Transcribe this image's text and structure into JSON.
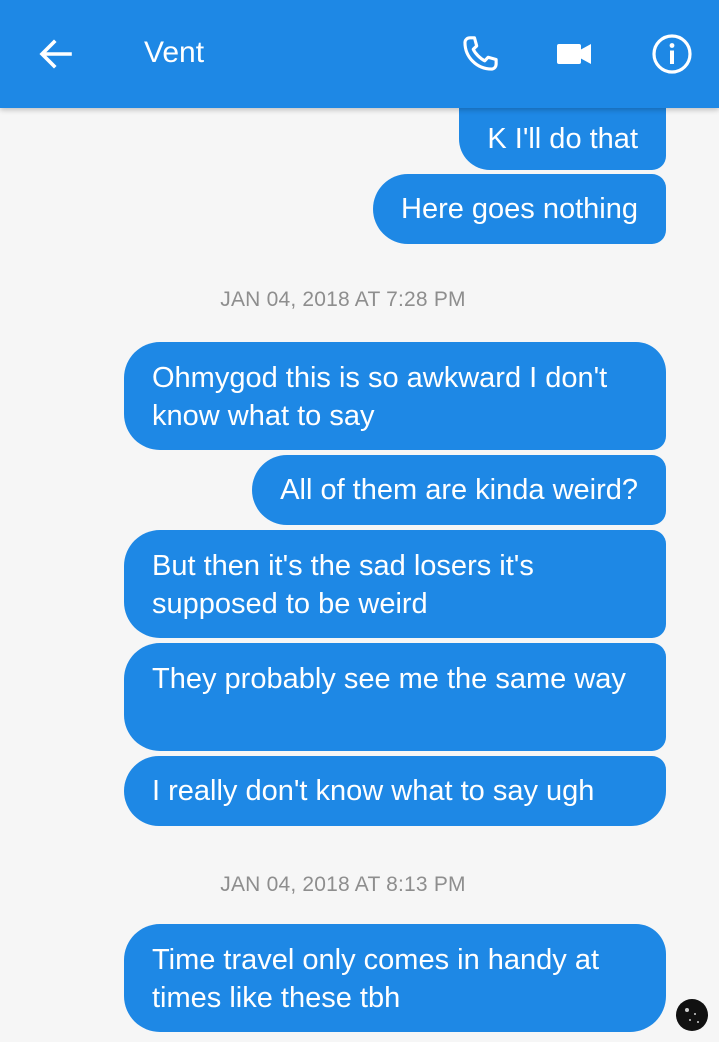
{
  "header": {
    "title": "Vent",
    "icons": {
      "back": "arrow-left-icon",
      "call": "phone-icon",
      "video": "video-camera-icon",
      "info": "info-icon"
    }
  },
  "colors": {
    "accent": "#1e88e5",
    "background": "#f6f6f6",
    "timestamp": "#8e8e8e"
  },
  "messages": {
    "m1": "K I'll do that",
    "m2": "Here goes nothing",
    "t1": "JAN 04, 2018 AT 7:28 PM",
    "m3": "Ohmygod this is so awkward I don't know what to say",
    "m4": "All of them are kinda weird?",
    "m5": "But then it's the sad losers it's supposed to be weird",
    "m6": "They probably see me the same way",
    "m7": "I really don't know what to say ugh",
    "t2": "JAN 04, 2018 AT 8:13 PM",
    "m8": "Time travel only comes in handy at times like these tbh"
  }
}
